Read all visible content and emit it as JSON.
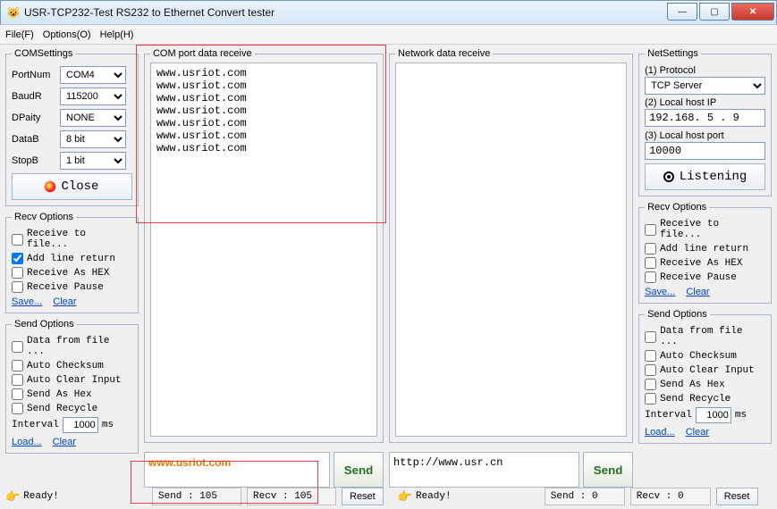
{
  "window": {
    "title": "USR-TCP232-Test  RS232 to Ethernet Convert tester"
  },
  "menu": {
    "file": "File(F)",
    "options": "Options(O)",
    "help": "Help(H)"
  },
  "comSettings": {
    "legend": "COMSettings",
    "portnum_label": "PortNum",
    "portnum": "COM4",
    "baud_label": "BaudR",
    "baud": "115200",
    "parity_label": "DPaity",
    "parity": "NONE",
    "datab_label": "DataB",
    "datab": "8 bit",
    "stopb_label": "StopB",
    "stopb": "1 bit",
    "close": "Close"
  },
  "netSettings": {
    "legend": "NetSettings",
    "proto_label": "(1) Protocol",
    "proto": "TCP Server",
    "ip_label": "(2) Local host IP",
    "ip": "192.168. 5 . 9",
    "port_label": "(3) Local host port",
    "port": "10000",
    "listen": "Listening"
  },
  "recvLeft": {
    "legend": "Recv Options",
    "to_file": "Receive to file...",
    "line_return": "Add line return",
    "as_hex": "Receive As HEX",
    "pause": "Receive Pause",
    "save": "Save...",
    "clear": "Clear"
  },
  "recvRight": {
    "legend": "Recv Options",
    "to_file": "Receive to file...",
    "line_return": "Add line return",
    "as_hex": "Receive As HEX",
    "pause": "Receive Pause",
    "save": "Save...",
    "clear": "Clear"
  },
  "sendLeft": {
    "legend": "Send Options",
    "from_file": "Data from file ...",
    "checksum": "Auto Checksum",
    "clear_input": "Auto Clear Input",
    "as_hex": "Send As Hex",
    "recycle": "Send Recycle",
    "interval_label": "Interval",
    "interval": "1000",
    "ms": "ms",
    "load": "Load...",
    "clear": "Clear"
  },
  "sendRight": {
    "legend": "Send Options",
    "from_file": "Data from file ...",
    "checksum": "Auto Checksum",
    "clear_input": "Auto Clear Input",
    "as_hex": "Send As Hex",
    "recycle": "Send Recycle",
    "interval_label": "Interval",
    "interval": "1000",
    "ms": "ms",
    "load": "Load...",
    "clear": "Clear"
  },
  "comRecv": {
    "legend": "COM port data receive",
    "lines": "www.usriot.com\nwww.usriot.com\nwww.usriot.com\nwww.usriot.com\nwww.usriot.com\nwww.usriot.com\nwww.usriot.com",
    "send_value": "www.usriot.com",
    "send_btn": "Send"
  },
  "netRecv": {
    "legend": "Network data receive",
    "lines": "",
    "send_value": "http://www.usr.cn",
    "send_btn": "Send"
  },
  "status": {
    "ready": "Ready!",
    "send_l": "Send : 105",
    "recv_l": "Recv : 105",
    "send_r": "Send : 0",
    "recv_r": "Recv : 0",
    "reset": "Reset"
  }
}
